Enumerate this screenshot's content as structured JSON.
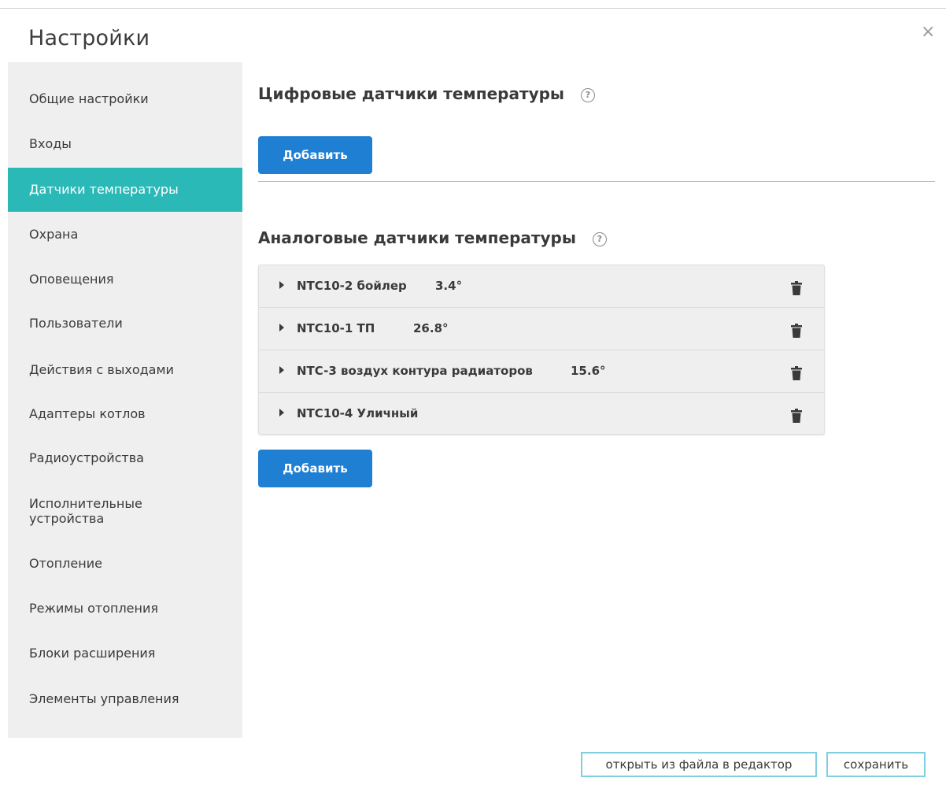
{
  "dialog": {
    "title": "Настройки",
    "close_symbol": "×"
  },
  "sidebar": {
    "items": [
      {
        "label": "Общие настройки",
        "active": false
      },
      {
        "label": "Входы",
        "active": false
      },
      {
        "label": "Датчики температуры",
        "active": true
      },
      {
        "label": "Охрана",
        "active": false
      },
      {
        "label": "Оповещения",
        "active": false
      },
      {
        "label": "Пользователи",
        "active": false
      },
      {
        "label": "Действия с выходами",
        "active": false
      },
      {
        "label": "Адаптеры котлов",
        "active": false
      },
      {
        "label": "Радиоустройства",
        "active": false
      },
      {
        "label": "Исполнительные устройства",
        "active": false
      },
      {
        "label": "Отопление",
        "active": false
      },
      {
        "label": "Режимы отопления",
        "active": false
      },
      {
        "label": "Блоки расширения",
        "active": false
      },
      {
        "label": "Элементы управления",
        "active": false
      }
    ]
  },
  "digital": {
    "title": "Цифровые датчики температуры",
    "help": "?",
    "add_label": "Добавить"
  },
  "analog": {
    "title": "Аналоговые датчики температуры",
    "help": "?",
    "add_label": "Добавить",
    "sensors": [
      {
        "name": "NTC10-2 бойлер",
        "temp": "3.4°"
      },
      {
        "name": "NTC10-1 ТП",
        "temp": "26.8°"
      },
      {
        "name": "NTC-3 воздух контура радиаторов",
        "temp": "15.6°"
      },
      {
        "name": "NTC10-4 Уличный",
        "temp": ""
      }
    ]
  },
  "footer": {
    "open_label": "открыть из файла в редактор",
    "save_label": "сохранить"
  },
  "colors": {
    "active_item": "#2bb9b8",
    "primary_button": "#1f7fd3",
    "outline_button_border": "#7ecfe0"
  }
}
